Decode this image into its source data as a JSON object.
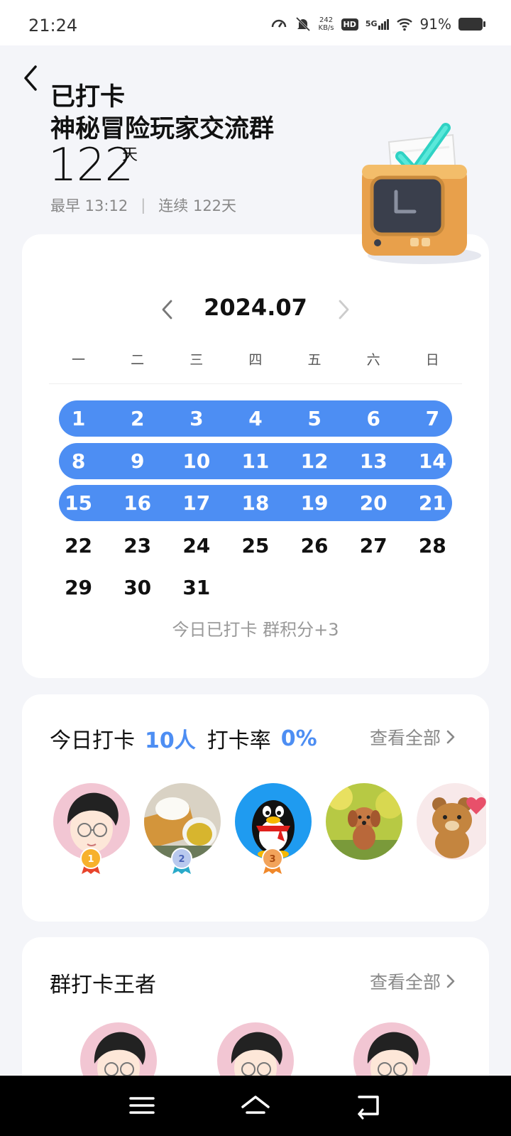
{
  "status_bar": {
    "time": "21:24",
    "net_speed_value": "242",
    "net_speed_unit": "KB/s",
    "hd": "HD",
    "signal_label": "5G",
    "battery": "91%"
  },
  "header": {
    "title_line1": "已打卡",
    "title_line2": "神秘冒险玩家交流群",
    "days_count": "122",
    "days_unit": "天",
    "earliest": "最早 13:12",
    "separator": "|",
    "streak": "连续 122天"
  },
  "calendar": {
    "month": "2024.07",
    "weekdays": [
      "一",
      "二",
      "三",
      "四",
      "五",
      "六",
      "日"
    ],
    "rows": [
      {
        "checked": true,
        "days": [
          "1",
          "2",
          "3",
          "4",
          "5",
          "6",
          "7"
        ]
      },
      {
        "checked": true,
        "days": [
          "8",
          "9",
          "10",
          "11",
          "12",
          "13",
          "14"
        ]
      },
      {
        "checked": true,
        "days": [
          "15",
          "16",
          "17",
          "18",
          "19",
          "20",
          "21"
        ]
      },
      {
        "checked": false,
        "days": [
          "22",
          "23",
          "24",
          "25",
          "26",
          "27",
          "28"
        ]
      },
      {
        "checked": false,
        "days": [
          "29",
          "30",
          "31"
        ]
      }
    ],
    "today_note": "今日已打卡  群积分+3"
  },
  "today_section": {
    "title_prefix": "今日打卡",
    "count": "10人",
    "rate_label": "打卡率",
    "rate": "0%",
    "view_all": "查看全部",
    "medals": [
      "1",
      "2",
      "3"
    ]
  },
  "king_section": {
    "title": "群打卡王者",
    "view_all": "查看全部"
  },
  "colors": {
    "accent": "#4d8ef3",
    "background": "#f4f5f9",
    "card": "#ffffff"
  }
}
